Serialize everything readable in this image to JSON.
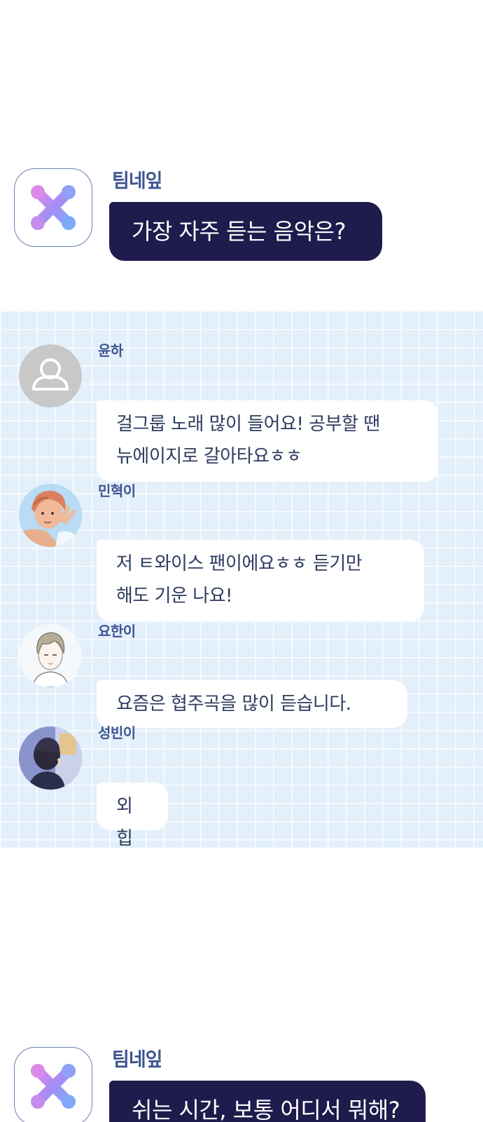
{
  "colors": {
    "host_bubble": "#1f1b4d",
    "host_name": "#3e5590",
    "chat_background": "#e3f0fb",
    "user_bubble": "#ffffff"
  },
  "questions": [
    {
      "host_name": "팀네잎",
      "text": "가장 자주 듣는 음악은?"
    },
    {
      "host_name": "팀네잎",
      "text": "쉬는 시간, 보통 어디서 뭐해?"
    }
  ],
  "answers": [
    {
      "name": "윤하",
      "avatar": "default-person-icon",
      "lines": [
        "걸그룹 노래 많이 들어요! 공부할 땐",
        "뉴에이지로 갈아타요ㅎㅎ"
      ]
    },
    {
      "name": "민혁이",
      "avatar": "minhyuk-portrait",
      "lines": [
        "저 ㅌ와이스 팬이에요ㅎㅎ 듣기만",
        "해도 기운 나요!"
      ]
    },
    {
      "name": "요한이",
      "avatar": "yohan-portrait",
      "lines": [
        "요즘은 협주곡을 많이 듣습니다."
      ]
    },
    {
      "name": "성빈이",
      "avatar": "seongbin-portrait",
      "lines": [
        "외힙"
      ]
    }
  ]
}
